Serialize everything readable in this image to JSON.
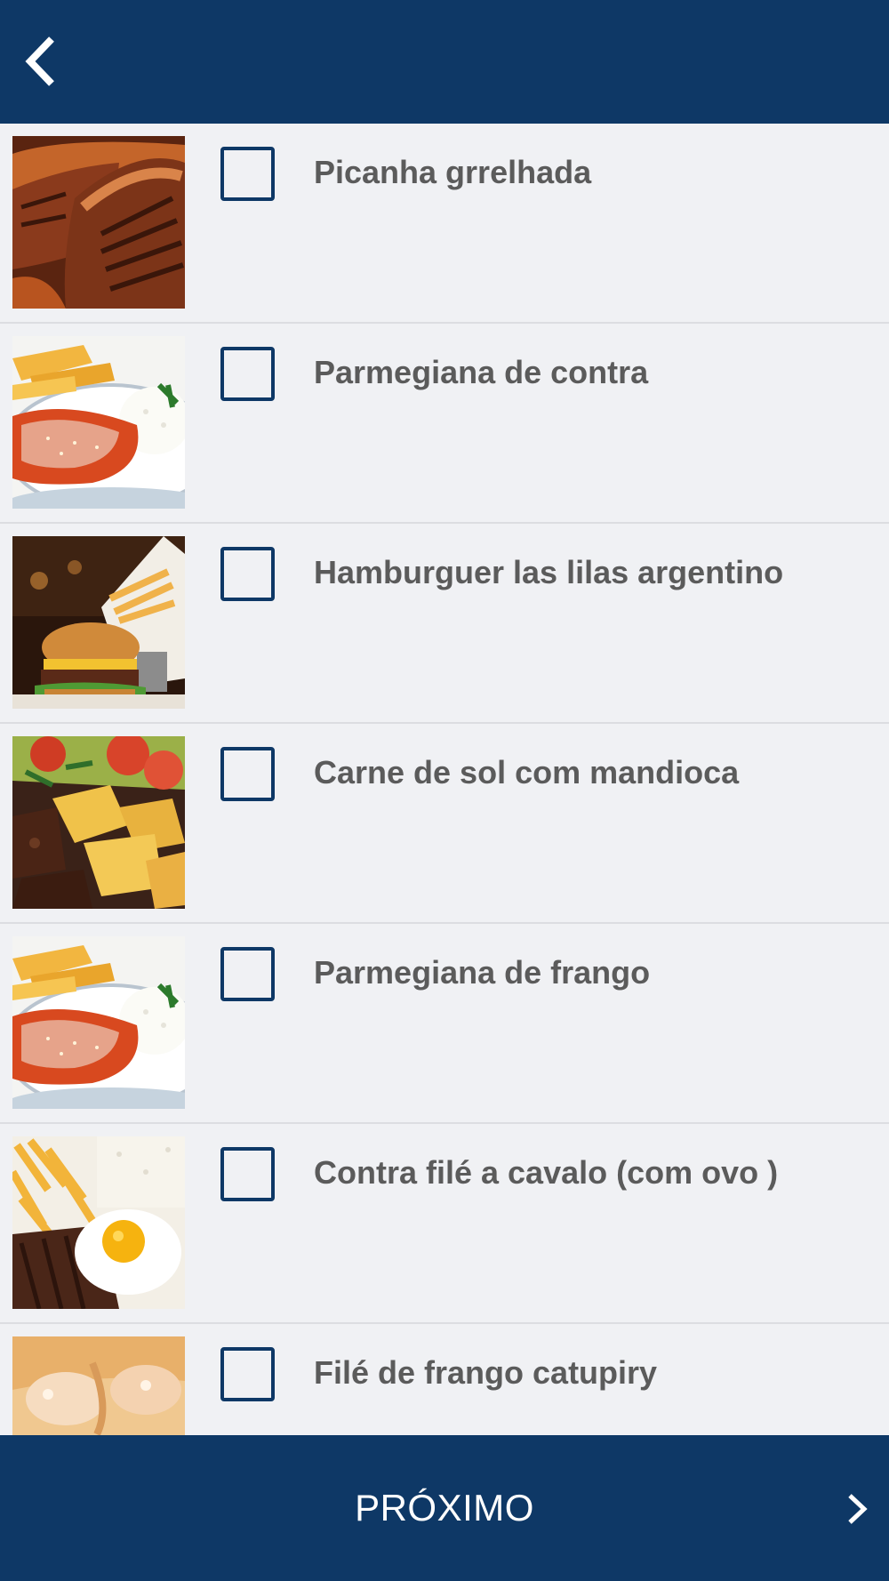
{
  "header": {
    "back_icon": "chevron-left-icon"
  },
  "colors": {
    "header_bg": "#0e3866",
    "list_bg": "#f0f1f4",
    "checkbox_border": "#0e3866",
    "label_text": "#5b5b5b",
    "footer_text": "#ffffff"
  },
  "menu": {
    "items": [
      {
        "label": "Picanha grrelhada",
        "image": "grilled-picanha-photo",
        "checked": false
      },
      {
        "label": "Parmegiana de contra",
        "image": "parmegiana-plate-photo",
        "checked": false
      },
      {
        "label": "Hamburguer las lilas argentino",
        "image": "burger-fries-photo",
        "checked": false
      },
      {
        "label": "Carne de sol com mandioca",
        "image": "carne-de-sol-cassava-photo",
        "checked": false
      },
      {
        "label": "Parmegiana de frango",
        "image": "parmegiana-plate-photo",
        "checked": false
      },
      {
        "label": "Contra filé a cavalo (com ovo )",
        "image": "steak-egg-fries-photo",
        "checked": false
      },
      {
        "label": "Filé de frango catupiry",
        "image": "chicken-catupiry-photo",
        "checked": false
      }
    ]
  },
  "footer": {
    "next_label": "PRÓXIMO",
    "next_icon": "chevron-right-icon"
  }
}
